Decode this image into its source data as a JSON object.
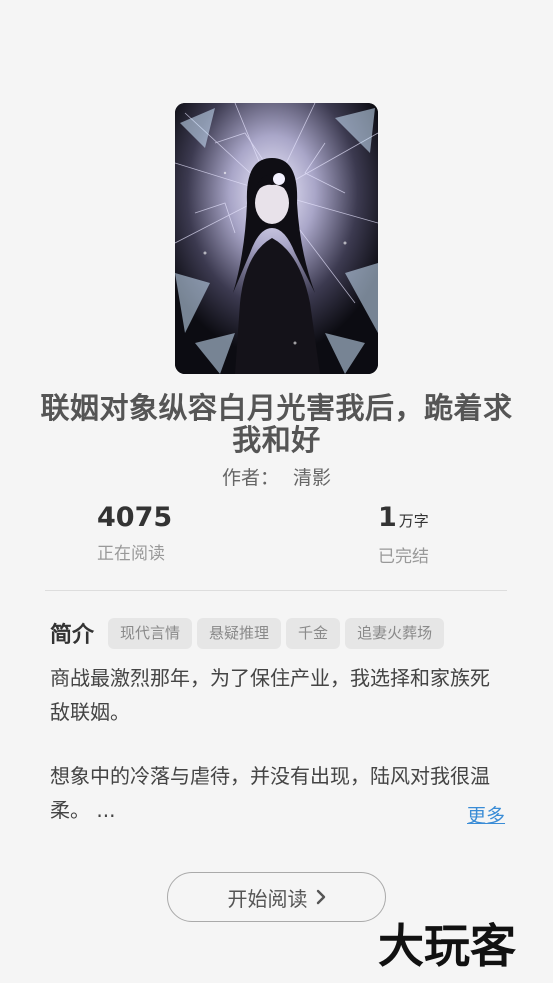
{
  "book": {
    "title": "联姻对象纵容白月光害我后，跪着求我和好",
    "author_label": "作者：",
    "author_name": "清影"
  },
  "stats": {
    "reading_count": "4075",
    "reading_label": "正在阅读",
    "word_count": "1",
    "word_unit": "万字",
    "status_label": "已完结"
  },
  "intro": {
    "heading": "简介",
    "tags": [
      "现代言情",
      "悬疑推理",
      "千金",
      "追妻火葬场"
    ],
    "paragraph_1": "商战最激烈那年，为了保住产业，我选择和家族死敌联姻。",
    "paragraph_2": "想象中的冷落与虐待，并没有出现，陆风对我很温柔。 ...",
    "more_label": "更多"
  },
  "actions": {
    "start_reading": "开始阅读"
  },
  "watermark": {
    "text": "大玩客"
  }
}
